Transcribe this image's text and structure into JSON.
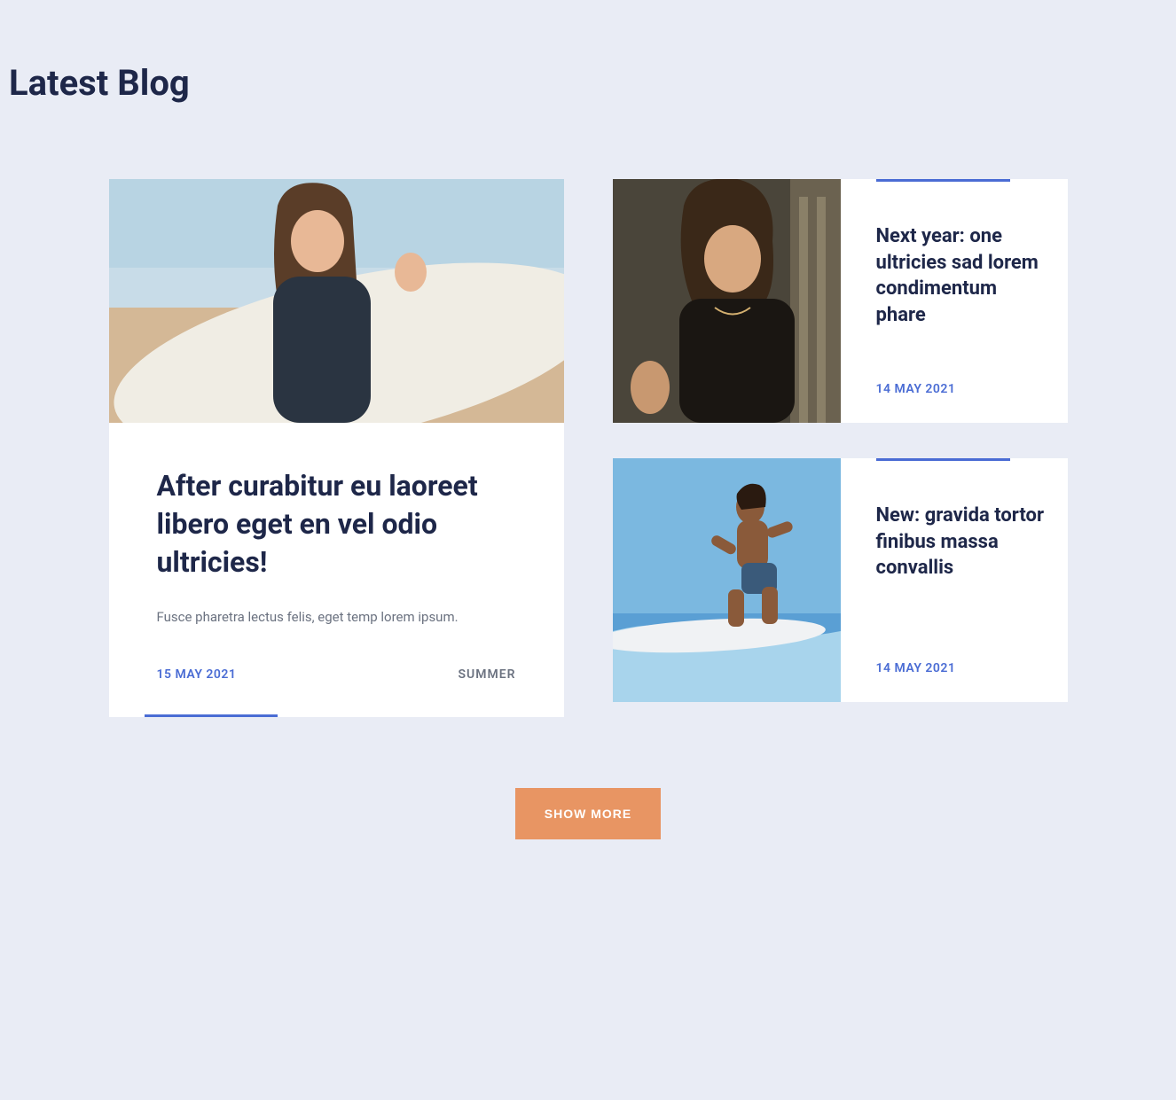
{
  "section_title": "Latest Blog",
  "featured": {
    "title": "After curabitur eu laoreet libero eget en vel odio ultricies!",
    "excerpt": "Fusce pharetra lectus felis, eget temp lorem ipsum.",
    "date": "15 MAY 2021",
    "category": "SUMMER"
  },
  "small_posts": [
    {
      "title": "Next year: one ultricies sad lorem condimentum phare",
      "date": "14 MAY 2021"
    },
    {
      "title": "New: gravida tortor finibus massa convallis",
      "date": "14 MAY 2021"
    }
  ],
  "show_more_label": "SHOW MORE"
}
